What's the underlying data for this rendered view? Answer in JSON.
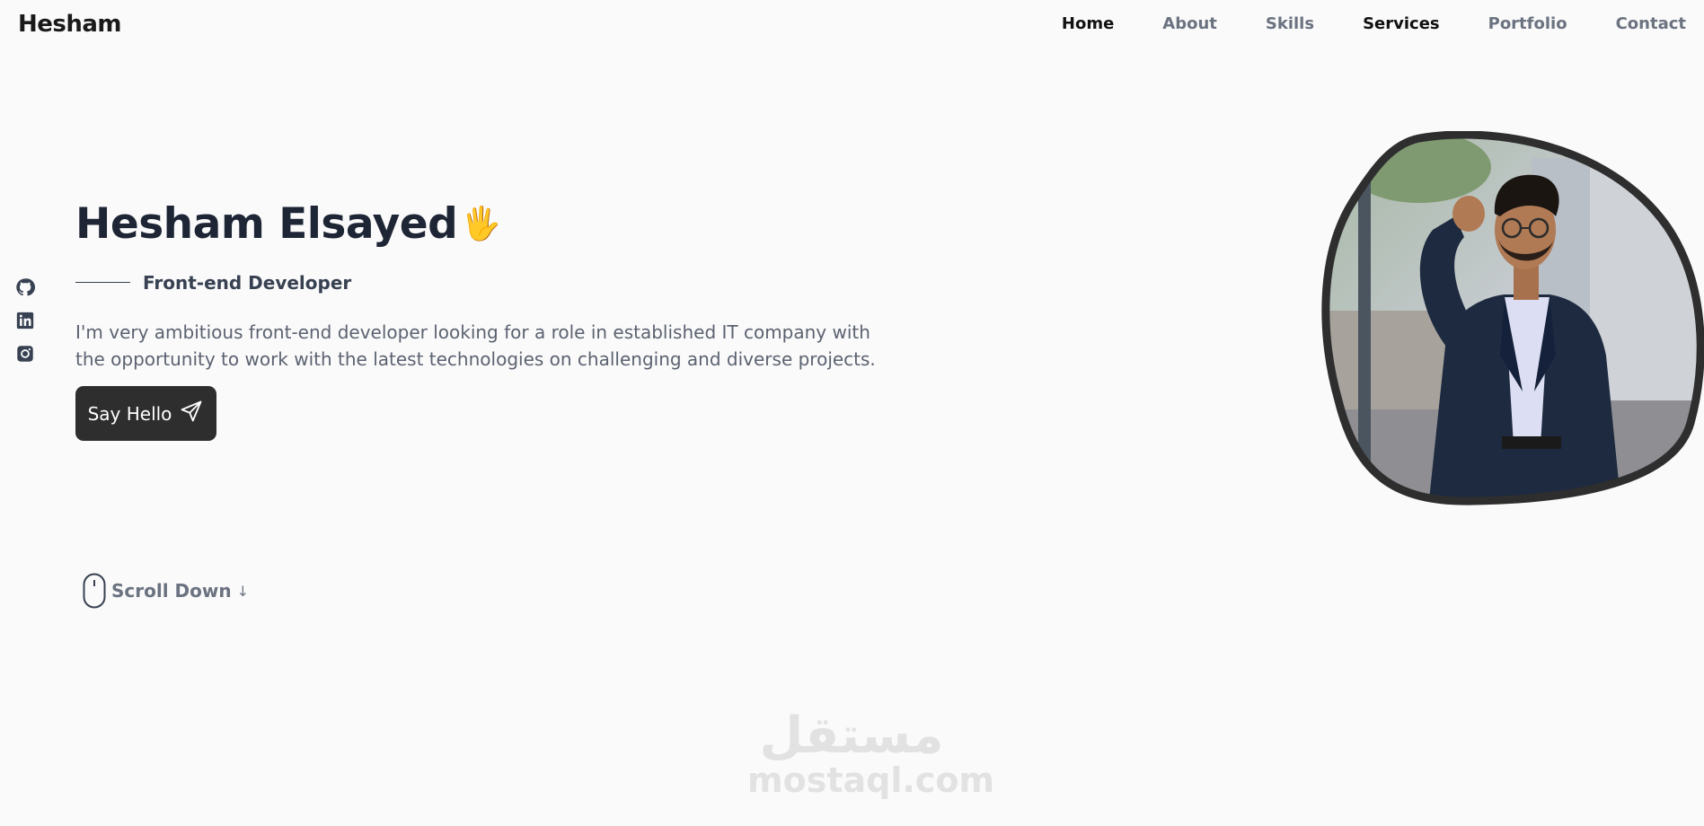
{
  "header": {
    "logo": "Hesham",
    "nav": [
      {
        "label": "Home"
      },
      {
        "label": "About"
      },
      {
        "label": "Skills"
      },
      {
        "label": "Services"
      },
      {
        "label": "Portfolio"
      },
      {
        "label": "Contact"
      }
    ]
  },
  "social": [
    "github-icon",
    "linkedin-icon",
    "instagram-icon"
  ],
  "hero": {
    "title": "Hesham Elsayed",
    "wave": "🖐",
    "subtitle": "Front-end Developer",
    "description": "I'm very ambitious front-end developer looking for a role in established IT company with the opportunity to work with the latest technologies on challenging and diverse projects.",
    "button_label": "Say Hello",
    "scroll_label": "Scroll Down",
    "scroll_arrow": "↓"
  },
  "watermark": {
    "arabic": "مستقل",
    "latin": "mostaql.com"
  },
  "colors": {
    "background": "#fafafa",
    "button": "#2e2e2e",
    "heading": "#1e2636",
    "text": "#5b6270"
  }
}
